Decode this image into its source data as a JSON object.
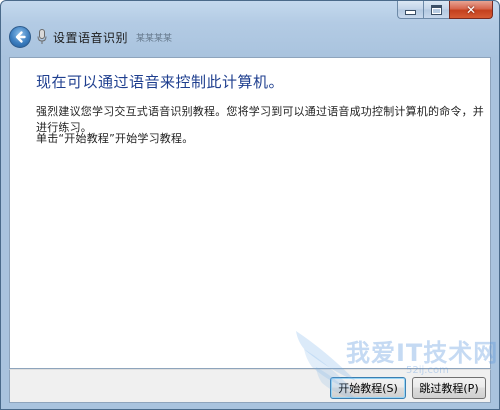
{
  "window": {
    "title": "设置语音识别",
    "title_extra": "某某某某"
  },
  "content": {
    "heading": "现在可以通过语音来控制此计算机。",
    "paragraph1": "强烈建议您学习交互式语音识别教程。您将学习到可以通过语音成功控制计算机的命令，并进行练习。",
    "paragraph2": "单击“开始教程”开始学习教程。"
  },
  "buttons": {
    "start_tutorial": "开始教程(S)",
    "skip_tutorial": "跳过教程(P)"
  },
  "watermark": {
    "text_main": "我爱IT技术网",
    "text_sub": "52ij.com"
  },
  "colors": {
    "heading": "#1f3f8f",
    "frame": "#a9c3de",
    "close_button": "#c4401e"
  },
  "icons": {
    "back": "back-arrow-icon",
    "mic": "microphone-icon",
    "minimize": "minimize-icon",
    "maximize": "maximize-icon",
    "close": "close-icon"
  }
}
